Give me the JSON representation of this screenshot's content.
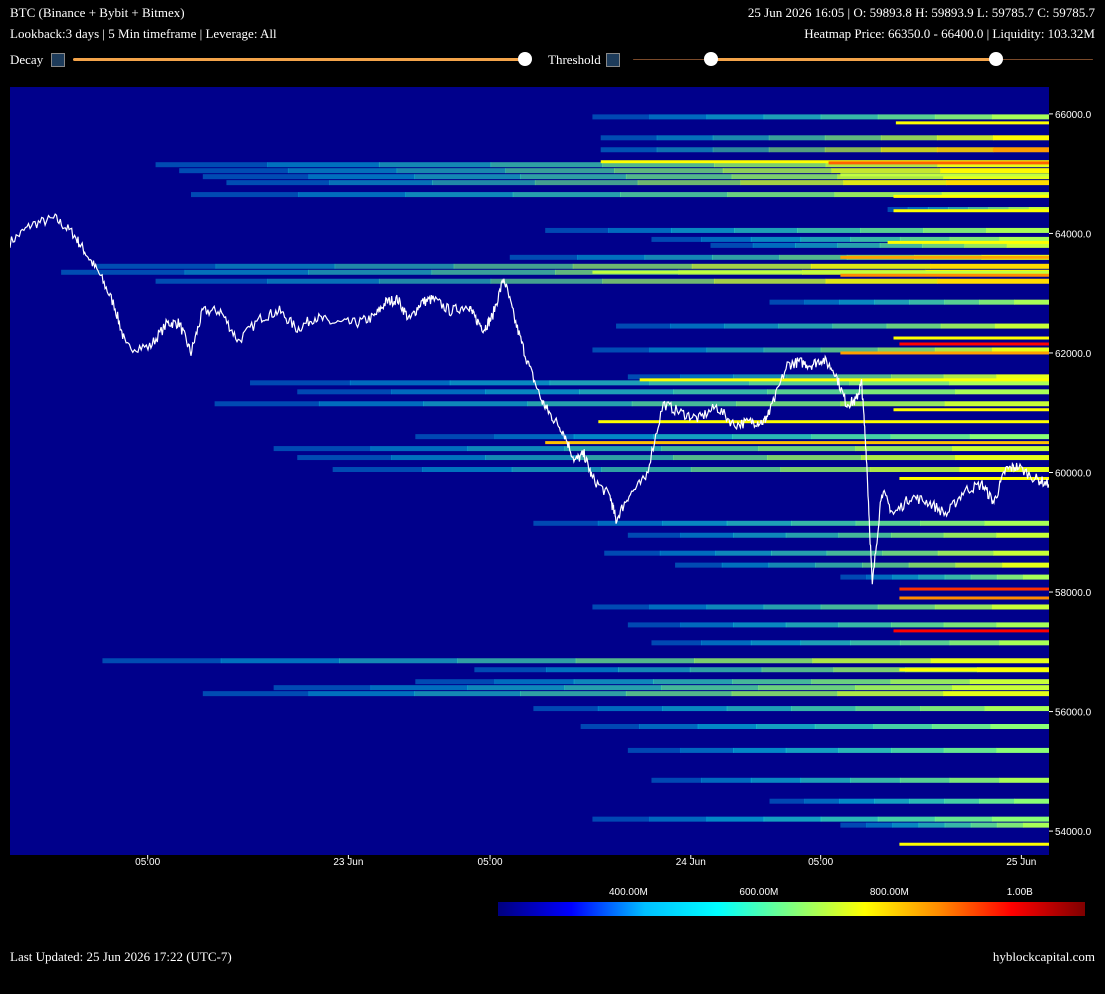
{
  "header": {
    "title": "BTC (Binance + Bybit + Bitmex)",
    "subtitle": "Lookback:3 days | 5 Min timeframe | Leverage: All",
    "ohlc": "25 Jun 2026 16:05 | O: 59893.8 H: 59893.9 L: 59785.7 C: 59785.7",
    "heatmap_info": "Heatmap Price: 66350.0 - 66400.0 | Liquidity: 103.32M"
  },
  "controls": {
    "decay_label": "Decay",
    "threshold_label": "Threshold",
    "decay_value": 1.0,
    "threshold_range": [
      0.17,
      0.79
    ]
  },
  "footer": {
    "last_updated": "Last Updated: 25 Jun 2026 17:22 (UTC-7)",
    "brand": "hyblockcapital.com"
  },
  "colors": {
    "background": "#000000",
    "heatmap_base": "#00008b",
    "price_line": "#ffffff",
    "slider": "#f4a44a"
  },
  "chart_data": {
    "type": "heatmap",
    "title": "",
    "xlabel": "",
    "ylabel": "",
    "ylim": [
      53600,
      66450
    ],
    "y_ticks": [
      54000,
      56000,
      58000,
      60000,
      62000,
      64000,
      66000
    ],
    "y_tick_labels": [
      "54000.0",
      "56000.0",
      "58000.0",
      "60000.0",
      "62000.0",
      "64000.0",
      "66000.0"
    ],
    "x_ticks": [
      {
        "h": 7.33,
        "label": "05:00"
      },
      {
        "h": 24.33,
        "label": "23 Jun"
      },
      {
        "h": 36.33,
        "label": "05:00"
      },
      {
        "h": 53.33,
        "label": "24 Jun"
      },
      {
        "h": 64.33,
        "label": "05:00"
      },
      {
        "h": 81.33,
        "label": "25 Jun"
      }
    ],
    "x_range_hours": [
      -4.33,
      83.67
    ],
    "colorbar": {
      "tick_labels": [
        "400.00M",
        "600.00M",
        "800.00M",
        "1.00B"
      ],
      "tick_values": [
        400,
        600,
        800,
        1000
      ],
      "range": [
        200,
        1100
      ],
      "stops": [
        "#00007f",
        "#0000ff",
        "#00bfff",
        "#00ffff",
        "#7fff7f",
        "#ffff00",
        "#ff8c00",
        "#ff0000",
        "#7f0000"
      ]
    },
    "liquidity_levels": [
      {
        "price": 65950,
        "start": 45.0,
        "intensity": 0.4
      },
      {
        "price": 65600,
        "start": 45.7,
        "intensity": 0.55
      },
      {
        "price": 65400,
        "start": 45.7,
        "intensity": 0.7
      },
      {
        "price": 65150,
        "start": 8.0,
        "intensity": 0.5
      },
      {
        "price": 65050,
        "start": 10.0,
        "intensity": 0.55
      },
      {
        "price": 64950,
        "start": 12.0,
        "intensity": 0.5
      },
      {
        "price": 64850,
        "start": 14.0,
        "intensity": 0.6
      },
      {
        "price": 64650,
        "start": 11.0,
        "intensity": 0.45
      },
      {
        "price": 64400,
        "start": 70.0,
        "intensity": 0.45
      },
      {
        "price": 64050,
        "start": 41.0,
        "intensity": 0.4
      },
      {
        "price": 63900,
        "start": 50.0,
        "intensity": 0.4
      },
      {
        "price": 63800,
        "start": 55.0,
        "intensity": 0.45
      },
      {
        "price": 63600,
        "start": 38.0,
        "intensity": 0.5
      },
      {
        "price": 63450,
        "start": 3.0,
        "intensity": 0.6
      },
      {
        "price": 63350,
        "start": 0.0,
        "intensity": 0.55
      },
      {
        "price": 63200,
        "start": 8.0,
        "intensity": 0.6
      },
      {
        "price": 62850,
        "start": 60.0,
        "intensity": 0.4
      },
      {
        "price": 62450,
        "start": 47.0,
        "intensity": 0.45
      },
      {
        "price": 62050,
        "start": 45.0,
        "intensity": 0.5
      },
      {
        "price": 61600,
        "start": 48.0,
        "intensity": 0.5
      },
      {
        "price": 61500,
        "start": 16.0,
        "intensity": 0.4
      },
      {
        "price": 61350,
        "start": 20.0,
        "intensity": 0.4
      },
      {
        "price": 61150,
        "start": 13.0,
        "intensity": 0.45
      },
      {
        "price": 60600,
        "start": 30.0,
        "intensity": 0.35
      },
      {
        "price": 60400,
        "start": 18.0,
        "intensity": 0.45
      },
      {
        "price": 60250,
        "start": 20.0,
        "intensity": 0.5
      },
      {
        "price": 60050,
        "start": 23.0,
        "intensity": 0.5
      },
      {
        "price": 59150,
        "start": 40.0,
        "intensity": 0.4
      },
      {
        "price": 58950,
        "start": 48.0,
        "intensity": 0.45
      },
      {
        "price": 58650,
        "start": 46.0,
        "intensity": 0.45
      },
      {
        "price": 58450,
        "start": 52.0,
        "intensity": 0.5
      },
      {
        "price": 58250,
        "start": 66.0,
        "intensity": 0.4
      },
      {
        "price": 57750,
        "start": 45.0,
        "intensity": 0.45
      },
      {
        "price": 57450,
        "start": 48.0,
        "intensity": 0.4
      },
      {
        "price": 57150,
        "start": 50.0,
        "intensity": 0.4
      },
      {
        "price": 56850,
        "start": 3.5,
        "intensity": 0.5
      },
      {
        "price": 56700,
        "start": 35.0,
        "intensity": 0.5
      },
      {
        "price": 56500,
        "start": 30.0,
        "intensity": 0.45
      },
      {
        "price": 56400,
        "start": 18.0,
        "intensity": 0.45
      },
      {
        "price": 56300,
        "start": 12.0,
        "intensity": 0.5
      },
      {
        "price": 56050,
        "start": 40.0,
        "intensity": 0.4
      },
      {
        "price": 55750,
        "start": 44.0,
        "intensity": 0.35
      },
      {
        "price": 55350,
        "start": 48.0,
        "intensity": 0.35
      },
      {
        "price": 54850,
        "start": 50.0,
        "intensity": 0.4
      },
      {
        "price": 54500,
        "start": 60.0,
        "intensity": 0.35
      },
      {
        "price": 54200,
        "start": 45.0,
        "intensity": 0.35
      },
      {
        "price": 54100,
        "start": 66.0,
        "intensity": 0.4
      }
    ],
    "hot_levels": [
      {
        "price": 65850,
        "start": 70.7,
        "color": "#ffff00"
      },
      {
        "price": 65200,
        "start": 45.7,
        "color": "#ffff00"
      },
      {
        "price": 65180,
        "start": 65.0,
        "color": "#ff6000"
      },
      {
        "price": 64980,
        "start": 66.0,
        "color": "#c0ff40"
      },
      {
        "price": 64620,
        "start": 70.5,
        "color": "#ffff00"
      },
      {
        "price": 64380,
        "start": 70.5,
        "color": "#ffff00"
      },
      {
        "price": 63850,
        "start": 70.0,
        "color": "#ffff00"
      },
      {
        "price": 63600,
        "start": 66.0,
        "color": "#ffa000"
      },
      {
        "price": 63350,
        "start": 45.0,
        "color": "#c0ff40"
      },
      {
        "price": 63300,
        "start": 66.0,
        "color": "#ff8c00"
      },
      {
        "price": 62250,
        "start": 70.5,
        "color": "#ffff00"
      },
      {
        "price": 62150,
        "start": 71.0,
        "color": "#ff0000"
      },
      {
        "price": 62000,
        "start": 66.0,
        "color": "#ffa000"
      },
      {
        "price": 61550,
        "start": 49.0,
        "color": "#ffff00"
      },
      {
        "price": 61050,
        "start": 70.5,
        "color": "#ffff00"
      },
      {
        "price": 60850,
        "start": 45.5,
        "color": "#ffff00"
      },
      {
        "price": 60500,
        "start": 41.0,
        "color": "#ffc000"
      },
      {
        "price": 59900,
        "start": 71.0,
        "color": "#ffff00"
      },
      {
        "price": 58050,
        "start": 71.0,
        "color": "#ff3000"
      },
      {
        "price": 57900,
        "start": 71.0,
        "color": "#ff8c00"
      },
      {
        "price": 57350,
        "start": 70.5,
        "color": "#ff0000"
      },
      {
        "price": 56700,
        "start": 71.0,
        "color": "#ffff00"
      },
      {
        "price": 53780,
        "start": 71.0,
        "color": "#ffff00"
      }
    ],
    "price_series": {
      "name": "",
      "x": [
        -4.33,
        -2.5,
        -0.5,
        1.0,
        2.0,
        3.3,
        4.5,
        5.5,
        7.5,
        9.0,
        10.0,
        11.0,
        12.0,
        13.5,
        15.0,
        17.0,
        18.5,
        20.0,
        21.5,
        23.0,
        25.0,
        26.5,
        27.5,
        28.5,
        29.5,
        30.5,
        31.5,
        33.0,
        34.5,
        35.0,
        35.8,
        36.5,
        37.5,
        38.5,
        39.5,
        40.7,
        41.5,
        42.5,
        43.5,
        44.3,
        45.0,
        46.5,
        47.0,
        48.0,
        49.5,
        51.0,
        52.5,
        54.0,
        55.5,
        57.0,
        58.5,
        59.5,
        60.0,
        61.5,
        62.5,
        63.5,
        64.5,
        65.5,
        66.5,
        67.3,
        67.8,
        68.2,
        68.7,
        69.5,
        70.5,
        72.0,
        73.5,
        75.0,
        76.5,
        78.0,
        79.0,
        80.0,
        81.0,
        82.5,
        83.67
      ],
      "y": [
        63850,
        64150,
        64250,
        64000,
        63700,
        63300,
        62800,
        62100,
        62100,
        62500,
        62500,
        62000,
        62700,
        62700,
        62200,
        62600,
        62700,
        62400,
        62600,
        62500,
        62500,
        62600,
        62850,
        62900,
        62550,
        62850,
        62900,
        62700,
        62800,
        62600,
        62400,
        62600,
        63250,
        62500,
        61850,
        61200,
        60950,
        60700,
        60200,
        60300,
        59900,
        59600,
        59200,
        59600,
        59900,
        61150,
        61000,
        60900,
        61100,
        60800,
        60850,
        60850,
        61000,
        61800,
        61850,
        61800,
        61900,
        61700,
        61150,
        61200,
        61500,
        60300,
        58100,
        59700,
        59300,
        59600,
        59500,
        59300,
        59700,
        59800,
        59500,
        60050,
        60100,
        59900,
        59800
      ]
    }
  }
}
